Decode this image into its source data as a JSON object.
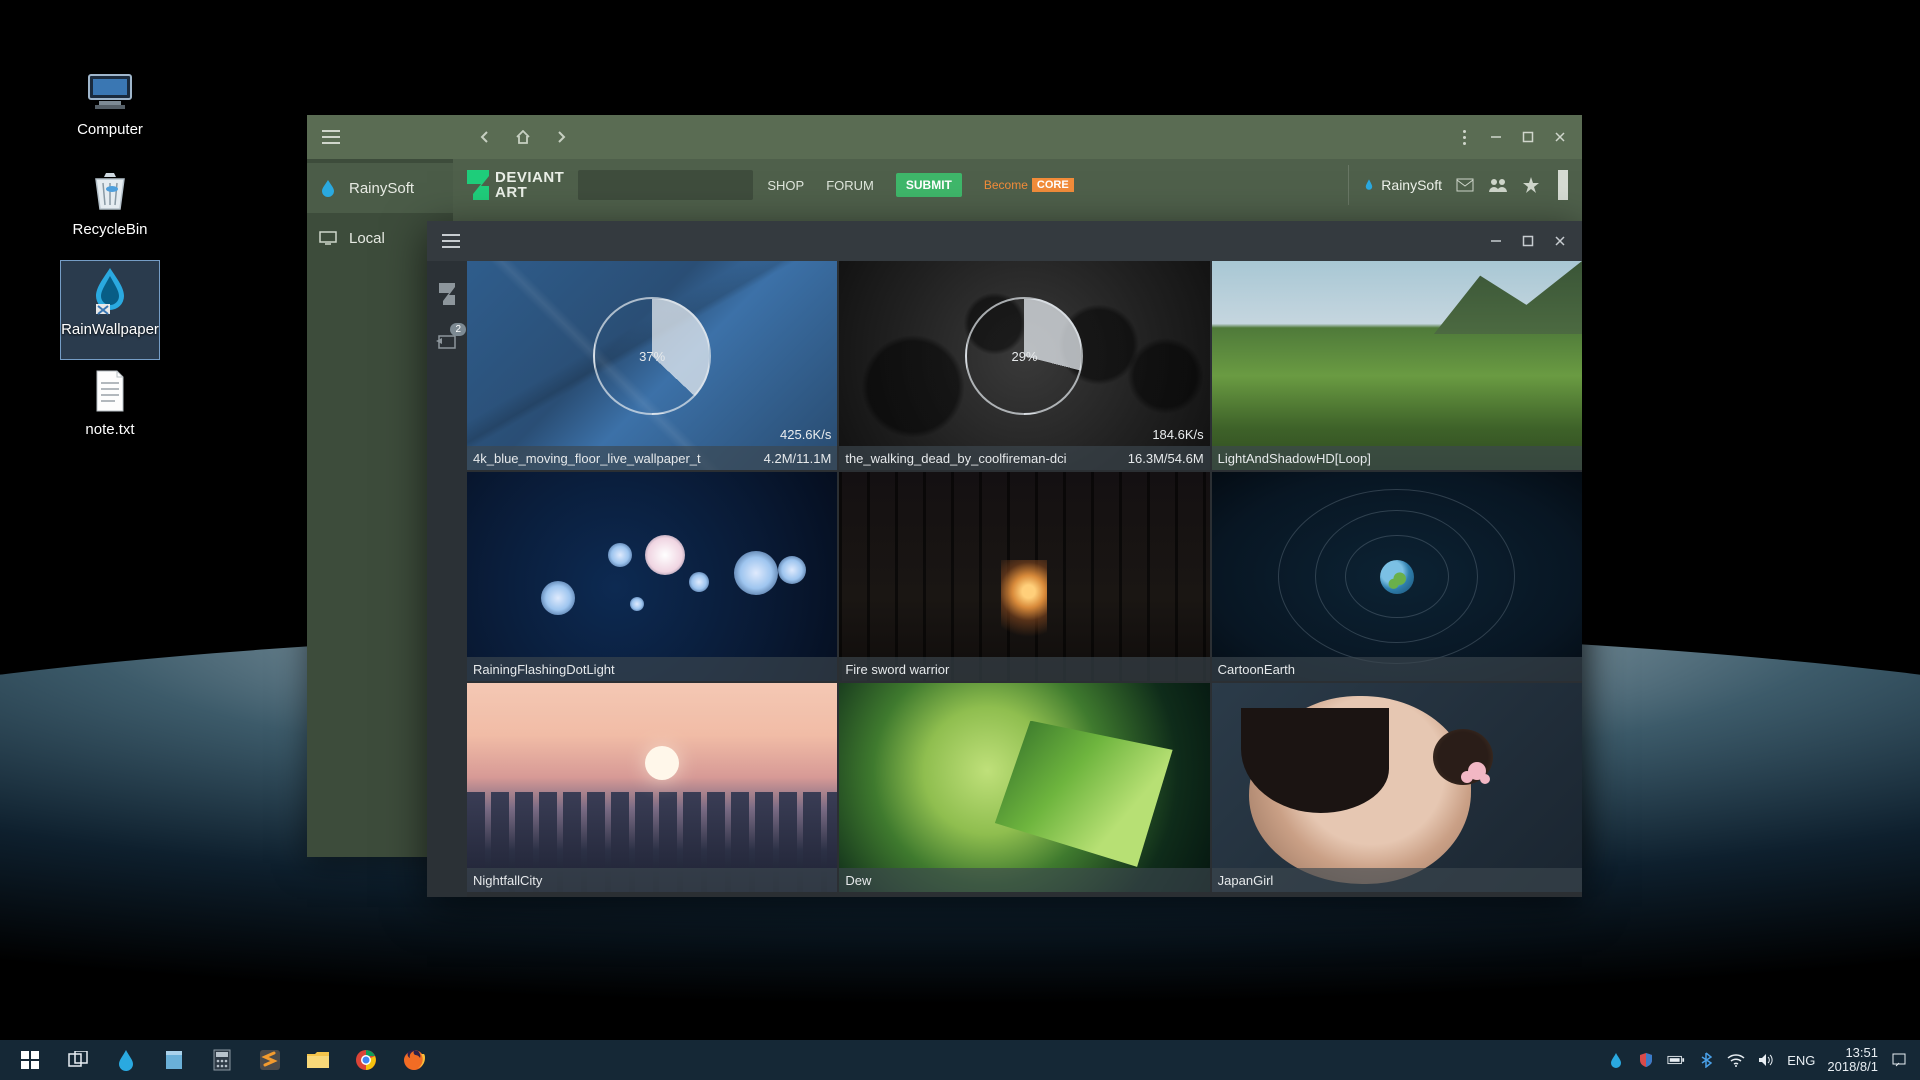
{
  "desktop": {
    "icons": [
      {
        "label": "Computer"
      },
      {
        "label": "RecycleBin"
      },
      {
        "label": "RainWallpaper"
      },
      {
        "label": "note.txt"
      }
    ],
    "selected_index": 2
  },
  "app1": {
    "sidebar": {
      "items": [
        {
          "label": "RainySoft"
        },
        {
          "label": "Local"
        }
      ],
      "active_index": 0
    },
    "nav": {
      "back": "‹",
      "home": "⌂",
      "forward": "›"
    },
    "deviantart": {
      "logo_line1": "DEVIANT",
      "logo_line2": "ART",
      "links": {
        "shop": "SHOP",
        "forum": "FORUM"
      },
      "submit": "SUBMIT",
      "become": "Become",
      "core": "CORE",
      "username": "RainySoft"
    }
  },
  "app2": {
    "vbar_badge": "2",
    "items": [
      {
        "title": "4k_blue_moving_floor_live_wallpaper_t",
        "progress": "4.2M/11.1M",
        "percent": "37%",
        "speed": "425.6K/s"
      },
      {
        "title": "the_walking_dead_by_coolfireman-dci",
        "progress": "16.3M/54.6M",
        "percent": "29%",
        "speed": "184.6K/s"
      },
      {
        "title": "LightAndShadowHD[Loop]"
      },
      {
        "title": "RainingFlashingDotLight"
      },
      {
        "title": "Fire sword warrior"
      },
      {
        "title": "CartoonEarth"
      },
      {
        "title": "NightfallCity"
      },
      {
        "title": "Dew"
      },
      {
        "title": "JapanGirl"
      }
    ]
  },
  "taskbar": {
    "lang": "ENG",
    "time": "13:51",
    "date": "2018/8/1"
  }
}
